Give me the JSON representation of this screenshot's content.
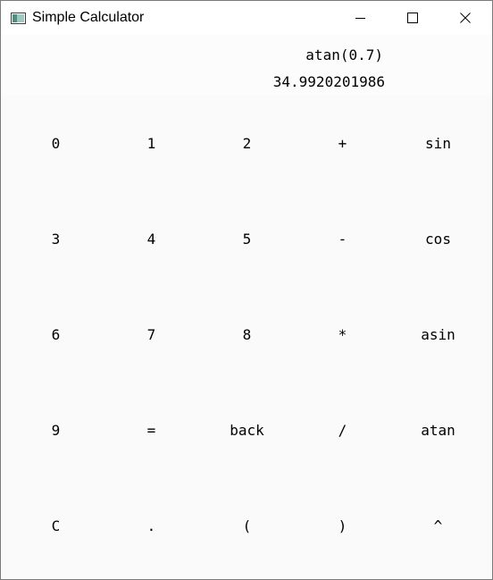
{
  "window": {
    "title": "Simple Calculator"
  },
  "titlebar_buttons": {
    "minimize_icon": "minimize-icon",
    "maximize_icon": "maximize-icon",
    "close_icon": "close-icon"
  },
  "display": {
    "expression": "atan(0.7)",
    "result": "34.9920201986"
  },
  "keys": [
    [
      "0",
      "1",
      "2",
      "+",
      "sin"
    ],
    [
      "3",
      "4",
      "5",
      "-",
      "cos"
    ],
    [
      "6",
      "7",
      "8",
      "*",
      "asin"
    ],
    [
      "9",
      "=",
      "back",
      "/",
      "atan"
    ],
    [
      "C",
      ".",
      "(",
      ")",
      "^"
    ]
  ]
}
